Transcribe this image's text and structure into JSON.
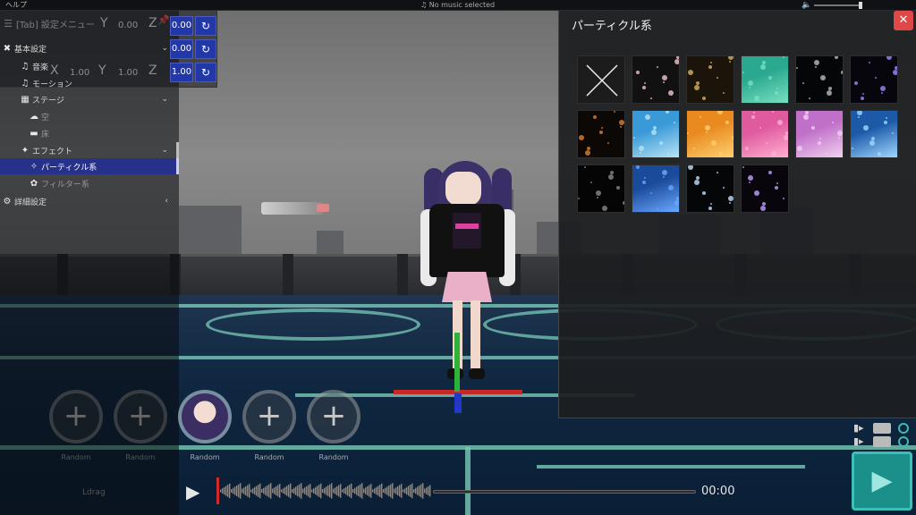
{
  "topbar": {
    "help": "ヘルプ",
    "music_icon": "♫",
    "music_status": "No music selected",
    "volume_icon": "speaker-icon"
  },
  "left_panel": {
    "header_title": "[Tab] 設定メニュー",
    "xyz": {
      "rows": [
        {
          "axis_y": "Y",
          "value_y": "0.00",
          "axis_z": "Z",
          "value": "0.00"
        },
        {
          "axis_y": "",
          "value_y": "",
          "axis_z": "",
          "value": "0.00"
        },
        {
          "axis_x": "X",
          "value_x": "1.00",
          "axis_y": "Y",
          "value_y": "1.00",
          "axis_z": "Z",
          "value": "1.00"
        }
      ]
    },
    "menu": {
      "basic": "基本設定",
      "music": "音楽",
      "motion": "モーション",
      "stage": "ステージ",
      "sky": "空",
      "floor": "床",
      "effects": "エフェクト",
      "particles": "パーティクル系",
      "filters": "フィルター系",
      "advanced": "詳細設定"
    }
  },
  "particle_panel": {
    "title": "パーティクル系",
    "close": "✕",
    "thumbnails": [
      {
        "name": "none",
        "colors": [
          "#1c1c1c"
        ]
      },
      {
        "name": "sakura",
        "colors": [
          "#111",
          "#f0c8d0"
        ]
      },
      {
        "name": "bokeh-warm",
        "colors": [
          "#1a140a",
          "#d8b060"
        ]
      },
      {
        "name": "green-glow",
        "colors": [
          "#2aa890",
          "#78e0c0"
        ]
      },
      {
        "name": "stars-dark",
        "colors": [
          "#050608",
          "#bbbbbb"
        ]
      },
      {
        "name": "stars-purple",
        "colors": [
          "#07060c",
          "#9a8aff"
        ]
      },
      {
        "name": "embers",
        "colors": [
          "#0b0805",
          "#e08030"
        ]
      },
      {
        "name": "sky-blue",
        "colors": [
          "#3a9ad8",
          "#b8e4f4"
        ]
      },
      {
        "name": "orange-bokeh",
        "colors": [
          "#e88a20",
          "#ffd070"
        ]
      },
      {
        "name": "pink",
        "colors": [
          "#e05aa0",
          "#ffb0d0"
        ]
      },
      {
        "name": "lavender",
        "colors": [
          "#c070c8",
          "#f0d0f0"
        ]
      },
      {
        "name": "light-rays",
        "colors": [
          "#1c5aa8",
          "#a0d8ff"
        ]
      },
      {
        "name": "dark-streaks",
        "colors": [
          "#050505",
          "#8a8a8a"
        ]
      },
      {
        "name": "blue-sparkle",
        "colors": [
          "#1a4a9a",
          "#6aa8ff"
        ]
      },
      {
        "name": "twinkle",
        "colors": [
          "#050608",
          "#c0e0ff"
        ]
      },
      {
        "name": "purple-twinkle",
        "colors": [
          "#08060c",
          "#c0a0ff"
        ]
      }
    ]
  },
  "slots": [
    {
      "label": "Random",
      "state": "dim"
    },
    {
      "label": "Random",
      "state": "dim"
    },
    {
      "label": "Random",
      "state": "avatar"
    },
    {
      "label": "Random",
      "state": "add"
    },
    {
      "label": "Random",
      "state": "add"
    }
  ],
  "timeline": {
    "time": "00:00",
    "progress": 0
  },
  "bottom_left": {
    "label": "Ldrag"
  },
  "colors": {
    "accent_blue": "#2238a8",
    "selected": "#26318a",
    "close_red": "#e04848",
    "play_teal": "#1b8f8a"
  }
}
